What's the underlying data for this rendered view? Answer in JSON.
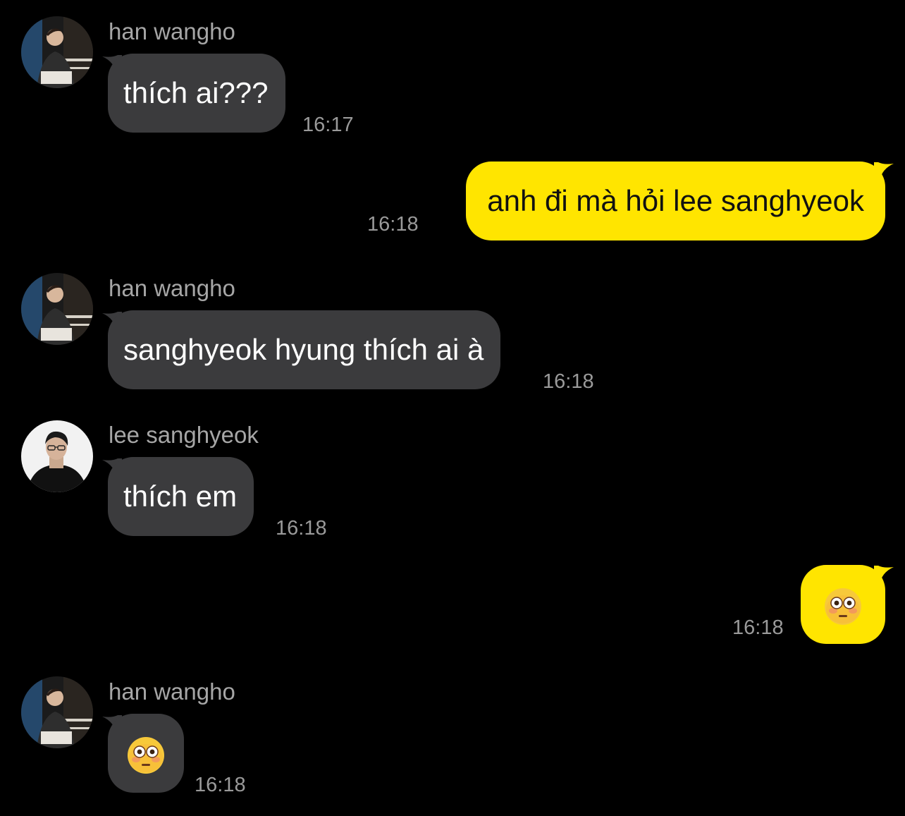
{
  "contacts": {
    "han": {
      "name": "han wangho",
      "avatar_icon": "han-wangho-avatar-icon"
    },
    "faker": {
      "name": "lee sanghyeok",
      "avatar_icon": "lee-sanghyeok-avatar-icon"
    }
  },
  "colors": {
    "background": "#000000",
    "incoming_bubble": "#3b3b3d",
    "outgoing_bubble": "#ffe500",
    "timestamp": "#9a9a9a"
  },
  "messages": [
    {
      "sender": "han wangho",
      "text": "thích ai???",
      "time": "16:17"
    },
    {
      "sender": "me",
      "text": "anh đi mà hỏi lee sanghyeok",
      "time": "16:18"
    },
    {
      "sender": "han wangho",
      "text": "sanghyeok hyung thích ai à",
      "time": "16:18"
    },
    {
      "sender": "lee sanghyeok",
      "text": "thích em",
      "time": "16:18"
    },
    {
      "sender": "me",
      "emoji": "flushed-face-emoji",
      "time": "16:18"
    },
    {
      "sender": "han wangho",
      "emoji": "flushed-face-emoji",
      "time": "16:18"
    }
  ]
}
